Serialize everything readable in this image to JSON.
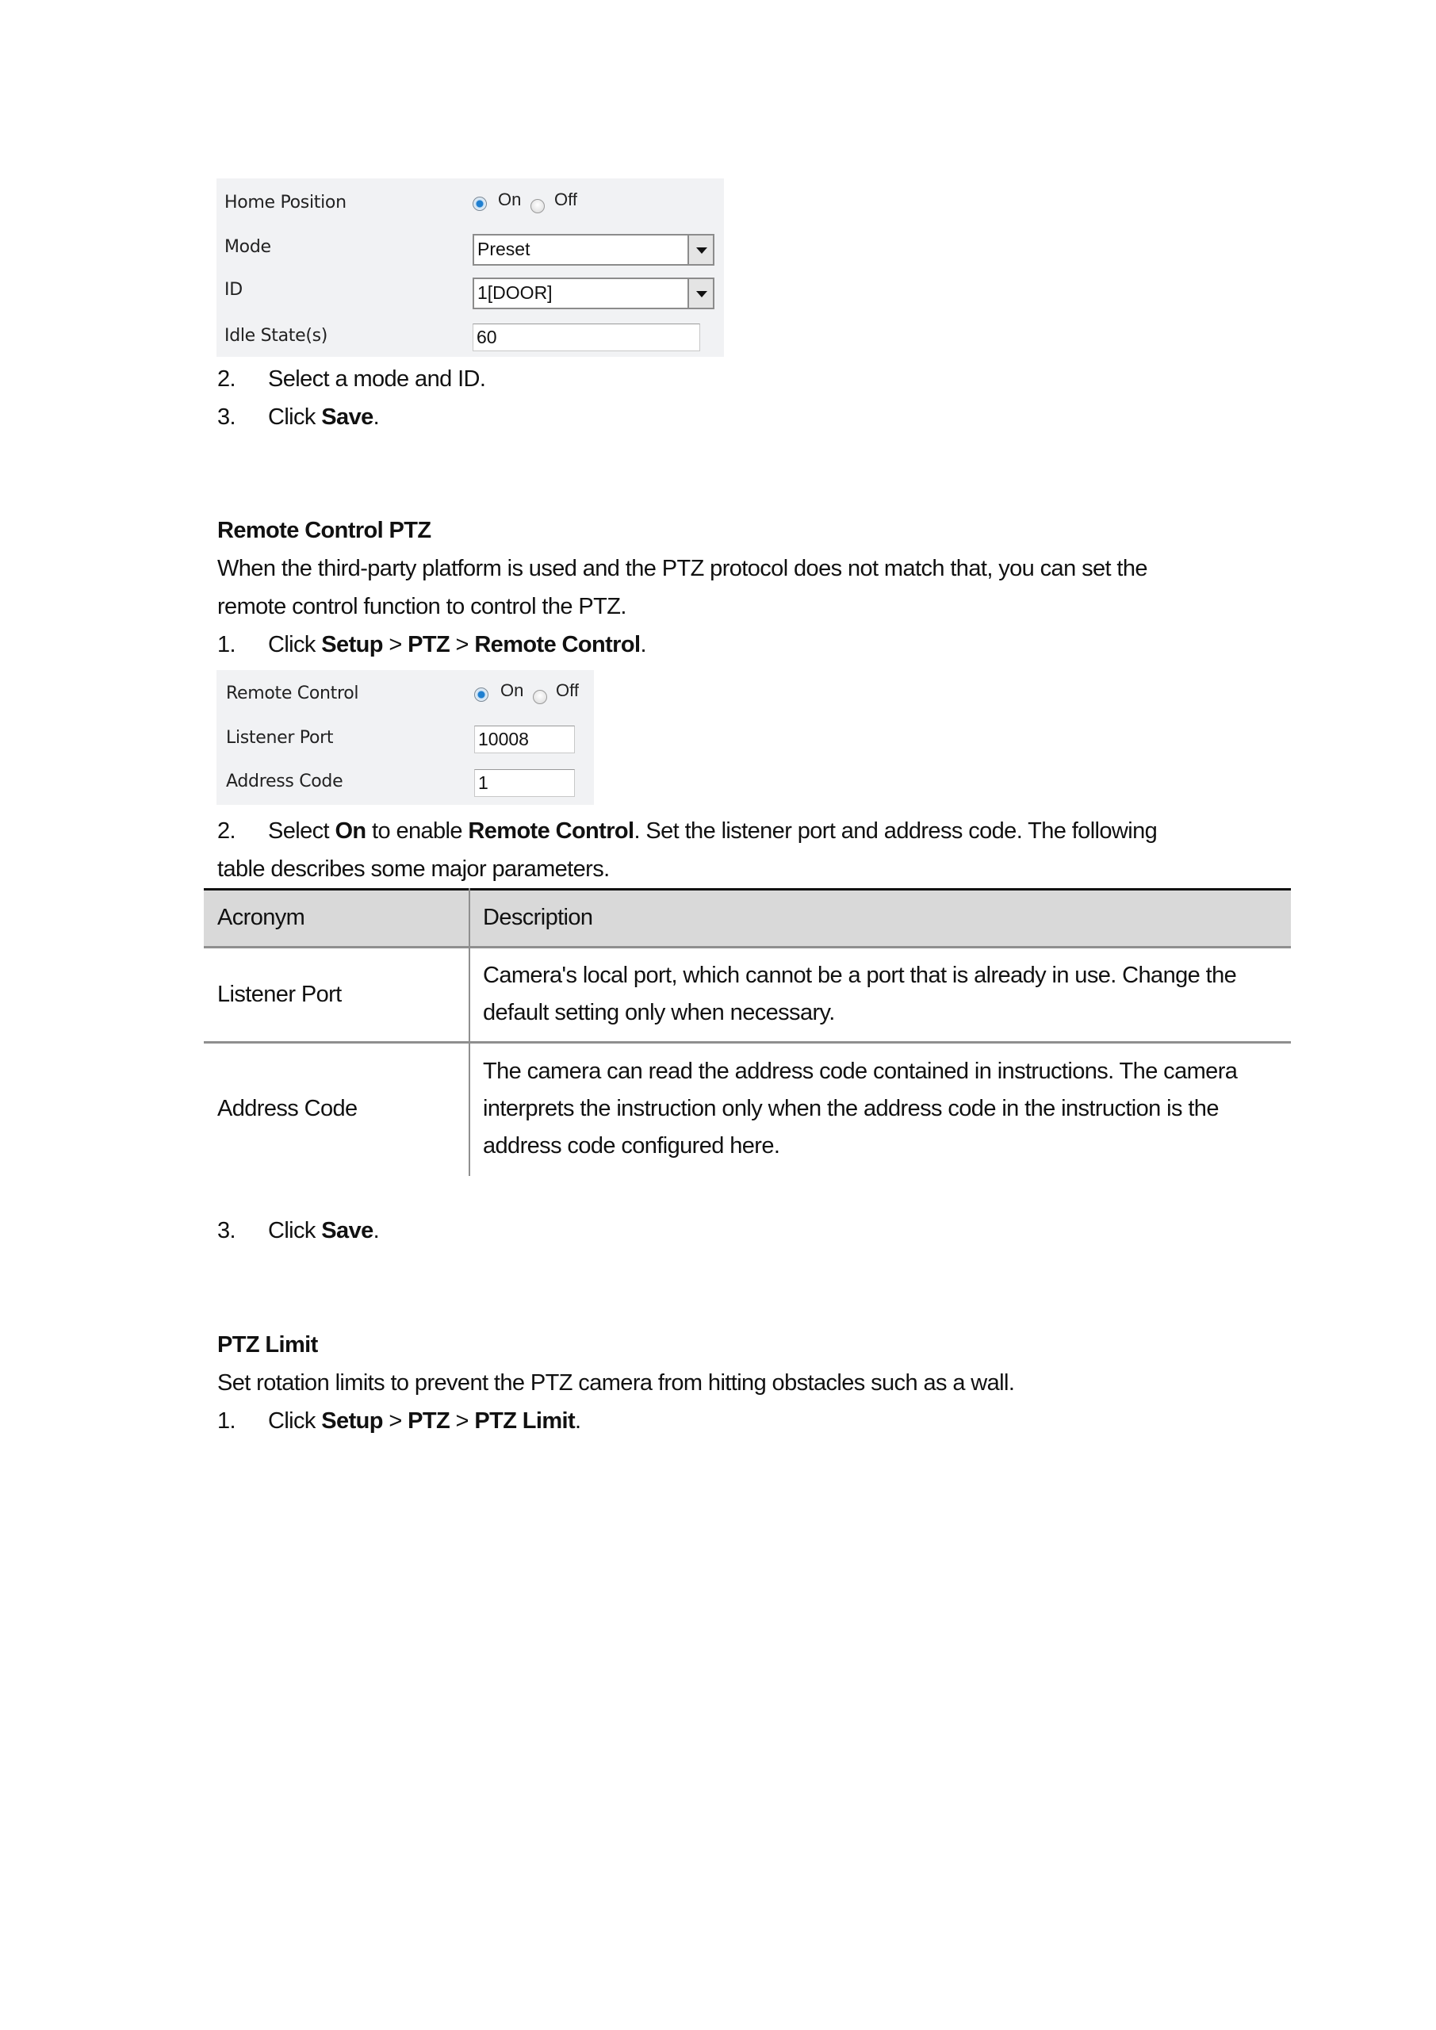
{
  "home_position_panel": {
    "rows": [
      {
        "label": "Home Position"
      },
      {
        "label": "Mode",
        "value": "Preset"
      },
      {
        "label": "ID",
        "value": "1[DOOR]"
      },
      {
        "label": "Idle State(s)",
        "value": "60"
      }
    ],
    "radio_on": "On",
    "radio_off": "Off",
    "selected": "On"
  },
  "steps_a": [
    {
      "num": "2.",
      "text": "Select a mode and ID."
    },
    {
      "num": "3.",
      "text_pre": "Click ",
      "bold": "Save",
      "text_post": "."
    }
  ],
  "section_remote": {
    "heading": "Remote Control PTZ",
    "para_line1": "When the third-party platform is used and the PTZ protocol does not match that, you can set the",
    "para_line2": "remote control function to control the PTZ.",
    "step1": {
      "num": "1.",
      "pre": "Click ",
      "b1": "Setup",
      "sep1": " > ",
      "b2": "PTZ",
      "sep2": " > ",
      "b3": "Remote Control",
      "post": "."
    }
  },
  "remote_panel": {
    "rows": [
      {
        "label": "Remote Control"
      },
      {
        "label": "Listener Port",
        "value": "10008"
      },
      {
        "label": "Address Code",
        "value": "1"
      }
    ],
    "radio_on": "On",
    "radio_off": "Off",
    "selected": "On"
  },
  "step2_remote": {
    "num": "2.",
    "pre": "Select ",
    "b1": "On",
    "mid": " to enable ",
    "b2": "Remote Control",
    "post": ". Set the listener port and address code. The following",
    "line2": "table describes some major parameters."
  },
  "param_table": {
    "headers": [
      "Acronym",
      "Description"
    ],
    "rows": [
      {
        "acronym": "Listener Port",
        "desc_lines": [
          "Camera's local port, which cannot be a port that is already in use. Change the",
          "default setting only when necessary."
        ]
      },
      {
        "acronym": "Address Code",
        "desc_lines": [
          "The camera can read the address code contained in instructions. The camera",
          "interprets the instruction only when the address code in the instruction is the",
          "address code configured here."
        ]
      }
    ]
  },
  "step3_remote": {
    "num": "3.",
    "pre": "Click ",
    "bold": "Save",
    "post": "."
  },
  "section_limit": {
    "heading": "PTZ Limit",
    "para": "Set rotation limits to prevent the PTZ camera from hitting obstacles such as a wall.",
    "step1": {
      "num": "1.",
      "pre": "Click ",
      "b1": "Setup",
      "sep1": " > ",
      "b2": "PTZ",
      "sep2": " > ",
      "b3": "PTZ Limit",
      "post": "."
    }
  }
}
